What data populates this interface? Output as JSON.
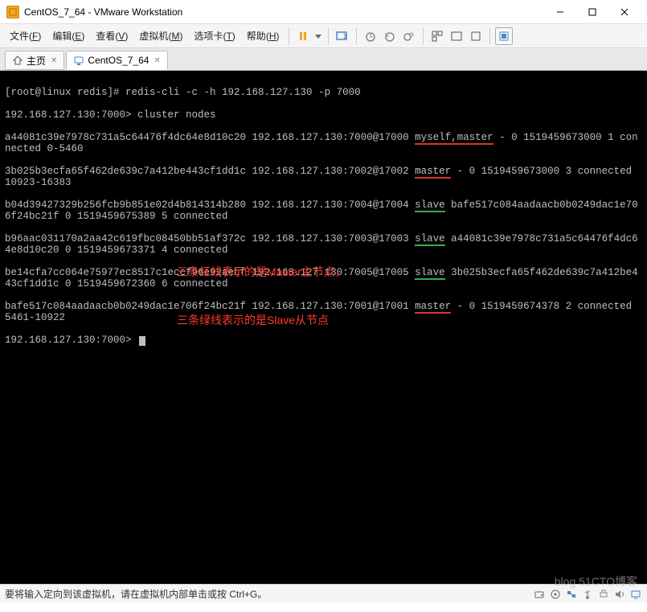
{
  "window": {
    "title": "CentOS_7_64 - VMware Workstation"
  },
  "menu": {
    "file": {
      "label": "文件",
      "key": "F"
    },
    "edit": {
      "label": "编辑",
      "key": "E"
    },
    "view": {
      "label": "查看",
      "key": "V"
    },
    "vm": {
      "label": "虚拟机",
      "key": "M"
    },
    "tabs": {
      "label": "选项卡",
      "key": "T"
    },
    "help": {
      "label": "帮助",
      "key": "H"
    }
  },
  "tabs": {
    "home": "主页",
    "vm": "CentOS_7_64"
  },
  "terminal": {
    "prompt1": "[root@linux redis]# redis-cli -c -h 192.168.127.130 -p 7000",
    "prompt2_pre": "192.168.127.130:7000>",
    "cmd2": " cluster nodes",
    "l1a": "a44081c39e7978c731a5c64476f4dc64e8d10c20 192.168.127.130:7000@17000 ",
    "l1b": "myself,master",
    "l1c": " - 0 1519459673000 1 connected 0-5460",
    "l2a": "3b025b3ecfa65f462de639c7a412be443cf1dd1c 192.168.127.130:7002@17002 ",
    "l2b": "master",
    "l2c": " - 0 1519459673000 3 connected 10923-16383",
    "l3a": "b04d39427329b256fcb9b851e02d4b814314b280 192.168.127.130:7004@17004 ",
    "l3b": "slave",
    "l3c": " bafe517c084aadaacb0b0249dac1e706f24bc21f 0 1519459675389 5 connected",
    "l4a": "b96aac031170a2aa42c619fbc08450bb51af372c 192.168.127.130:7003@17003 ",
    "l4b": "slave",
    "l4c": " a44081c39e7978c731a5c64476f4dc64e8d10c20 0 1519459673371 4 connected",
    "l5a": "be14cfa7cc064e75977ec8517c1eccf96e92aebf 192.168.127.130:7005@17005 ",
    "l5b": "slave",
    "l5c": " 3b025b3ecfa65f462de639c7a412be443cf1dd1c 0 1519459672360 6 connected",
    "l6a": "bafe517c084aadaacb0b0249dac1e706f24bc21f 192.168.127.130:7001@17001 ",
    "l6b": "master",
    "l6c": " - 0 1519459674378 2 connected 5461-10922",
    "prompt3": "192.168.127.130:7000> ",
    "annotation_line1": "三条红线表示的是Master主节点，",
    "annotation_line2": "三条绿线表示的是Slave从节点"
  },
  "statusbar": {
    "text": "要将输入定向到该虚拟机，请在虚拟机内部单击或按 Ctrl+G。"
  },
  "watermark": "blog 51CTO博客"
}
